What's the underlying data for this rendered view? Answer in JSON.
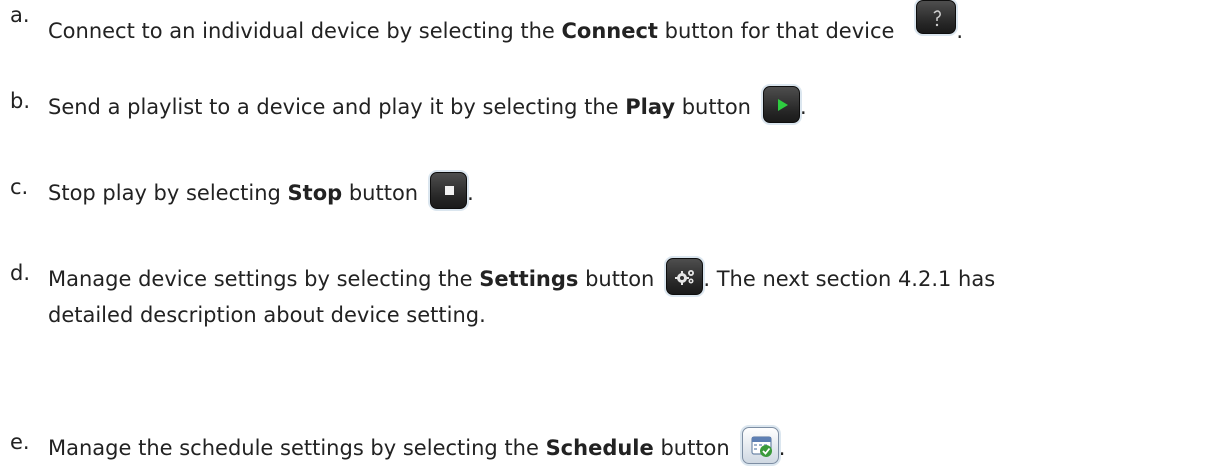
{
  "items": [
    {
      "letter": "a.",
      "before": "Connect to an individual device by selecting the ",
      "bold": "Connect",
      "after": " button for that device",
      "end": ".",
      "icon": "connect-icon"
    },
    {
      "letter": "b.",
      "before": "Send a playlist to a device and play it by selecting the ",
      "bold": "Play",
      "after": " button",
      "end": ".",
      "icon": "play-icon"
    },
    {
      "letter": "c.",
      "before": "Stop play by selecting ",
      "bold": "Stop",
      "after": " button",
      "end": ".",
      "icon": "stop-icon"
    },
    {
      "letter": "d.",
      "before": "Manage device settings by selecting the ",
      "bold": "Settings",
      "after": " button",
      "end": ". The next section 4.2.1 has",
      "line2": "detailed description about device setting.",
      "icon": "gears-icon"
    },
    {
      "letter": "e.",
      "before": "Manage the schedule settings by selecting the ",
      "bold": "Schedule",
      "after": " button",
      "end": ".",
      "icon": "calendar-check-icon"
    }
  ],
  "colors": {
    "text": "#222222",
    "button_dark": "#2a2a2a",
    "play_green": "#2ecc40",
    "check_green": "#3a9a3a"
  }
}
